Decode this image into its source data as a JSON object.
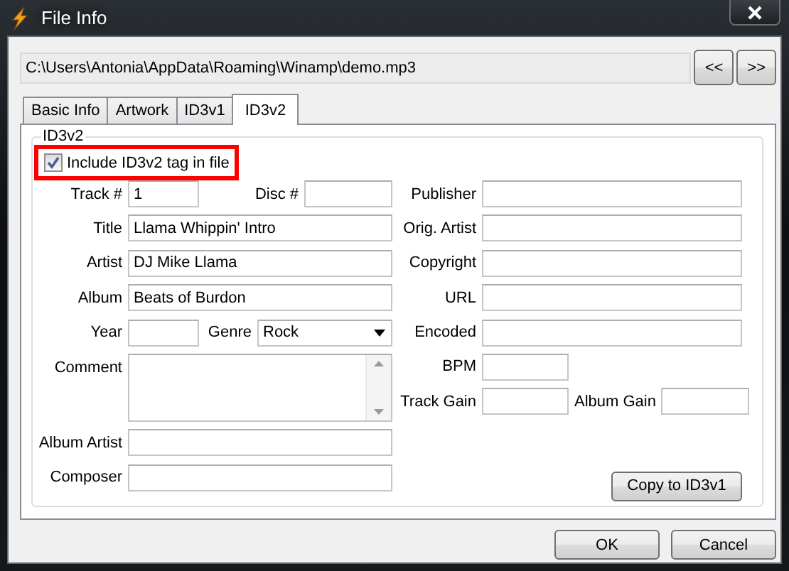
{
  "window": {
    "title": "File Info"
  },
  "file_path": "C:\\Users\\Antonia\\AppData\\Roaming\\Winamp\\demo.mp3",
  "nav_buttons": [
    "<<",
    ">>"
  ],
  "tabs": [
    {
      "label": "Basic Info",
      "selected": false
    },
    {
      "label": "Artwork",
      "selected": false
    },
    {
      "label": "ID3v1",
      "selected": false
    },
    {
      "label": "ID3v2",
      "selected": true
    }
  ],
  "group": {
    "title": "ID3v2",
    "include_tag": {
      "label": "Include ID3v2 tag in file",
      "checked": true,
      "highlighted": true
    },
    "left_rows": [
      [
        {
          "label": "Track #",
          "value": "1",
          "kind": "short"
        },
        {
          "label": "Disc #",
          "kind": "text"
        }
      ],
      [
        {
          "label": "Title",
          "value": "Llama Whippin' Intro",
          "kind": "text"
        }
      ],
      [
        {
          "label": "Artist",
          "value": "DJ Mike Llama",
          "kind": "text"
        }
      ],
      [
        {
          "label": "Album",
          "value": "Beats of Burdon",
          "kind": "text"
        }
      ],
      [
        {
          "label": "Year",
          "kind": "short"
        },
        {
          "label": "Genre",
          "value": "Rock",
          "kind": "select"
        }
      ],
      [
        {
          "label": "Comment",
          "kind": "multiline"
        }
      ],
      [
        {
          "label": "Album Artist",
          "kind": "text"
        }
      ],
      [
        {
          "label": "Composer",
          "kind": "text"
        }
      ]
    ],
    "right_rows": [
      [
        {
          "label": "Publisher",
          "kind": "text"
        }
      ],
      [
        {
          "label": "Orig. Artist",
          "kind": "text"
        }
      ],
      [
        {
          "label": "Copyright",
          "kind": "text"
        }
      ],
      [
        {
          "label": "URL",
          "kind": "text"
        }
      ],
      [
        {
          "label": "Encoded",
          "kind": "text"
        }
      ],
      [
        {
          "label": "BPM",
          "kind": "short"
        }
      ],
      [
        {
          "label": "Track Gain",
          "kind": "short"
        },
        {
          "label": "Album Gain",
          "kind": "text"
        }
      ]
    ],
    "copy_button": "Copy to ID3v1"
  },
  "buttons": [
    "OK",
    "Cancel"
  ]
}
